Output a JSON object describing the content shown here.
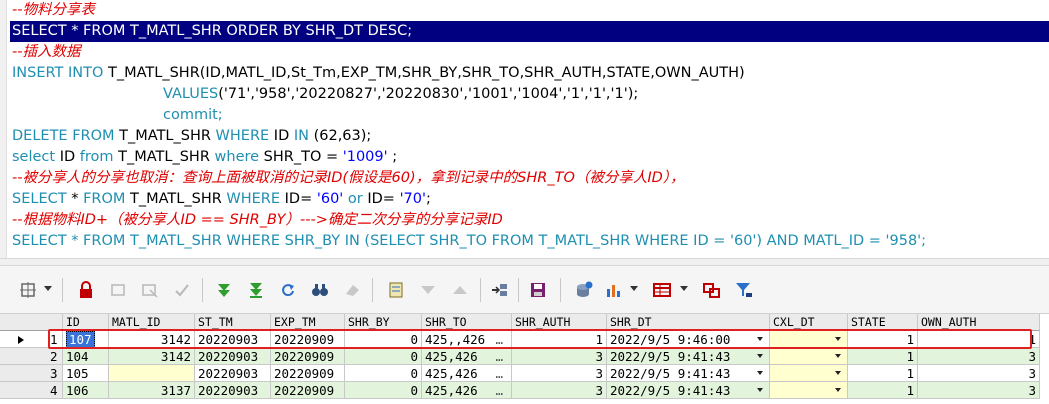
{
  "editor": {
    "lines": [
      {
        "kind": "comment",
        "text": "--物料分享表"
      },
      {
        "kind": "selected",
        "text": "SELECT * FROM T_MATL_SHR ORDER BY SHR_DT DESC;"
      },
      {
        "kind": "comment",
        "text": "--插入数据"
      },
      {
        "kind": "insert",
        "kw": "INSERT INTO",
        "rest": " T_MATL_SHR(ID,MATL_ID,St_Tm,EXP_TM,SHR_BY,SHR_TO,SHR_AUTH,STATE,OWN_AUTH)"
      },
      {
        "kind": "values",
        "kw": "VALUES",
        "rest": "('71','958','20220827','20220830','1001','1004','1','1','1');"
      },
      {
        "kind": "commit",
        "text": "commit;"
      },
      {
        "kind": "delete",
        "kw": "DELETE FROM",
        "rest": " T_MATL_SHR ",
        "kw2": "WHERE",
        "rest2": " ID ",
        "kw3": "IN",
        "rest3": " (62,63);"
      },
      {
        "kind": "select2",
        "kw": "select",
        "rest": " ID ",
        "kw2": "from",
        "rest2": " T_MATL_SHR ",
        "kw3": "where",
        "rest3": " SHR_TO = ",
        "str": "'1009'",
        "rest4": " ;"
      },
      {
        "kind": "comment",
        "text": "--被分享人的分享也取消：查询上面被取消的记录ID(假设是60)，拿到记录中的SHR_TO（被分享人ID），"
      },
      {
        "kind": "select3",
        "kw": "SELECT",
        "rest": " * ",
        "kw2": "FROM",
        "rest2": " T_MATL_SHR ",
        "kw3": "WHERE",
        "rest3": " ID= ",
        "str": "'60'",
        "kw4": " or ",
        "rest4": "ID= ",
        "str2": "'70'",
        "rest5": ";"
      },
      {
        "kind": "comment",
        "text": "--根据物料ID+（被分享人ID == SHR_BY）--->确定二次分享的分享记录ID"
      },
      {
        "kind": "select4",
        "text": "SELECT * FROM T_MATL_SHR WHERE SHR_BY IN (SELECT SHR_TO FROM T_MATL_SHR WHERE ID = '60') AND MATL_ID = '958';"
      }
    ]
  },
  "grid": {
    "columns": [
      "",
      "ID",
      "MATL_ID",
      "ST_TM",
      "EXP_TM",
      "SHR_BY",
      "SHR_TO",
      "SHR_AUTH",
      "SHR_DT",
      "CXL_DT",
      "STATE",
      "OWN_AUTH"
    ],
    "rows": [
      {
        "num": "1",
        "id": "107",
        "matl": "3142",
        "st": "20220903",
        "exp": "20220909",
        "by": "0",
        "to": "425,,426",
        "auth": "1",
        "dt": "2022/9/5 9:46:00",
        "cxl": "",
        "state": "1",
        "own": "1"
      },
      {
        "num": "2",
        "id": "104",
        "matl": "3142",
        "st": "20220903",
        "exp": "20220909",
        "by": "0",
        "to": "425,426",
        "auth": "3",
        "dt": "2022/9/5 9:41:43",
        "cxl": "",
        "state": "1",
        "own": "3"
      },
      {
        "num": "3",
        "id": "105",
        "matl": "",
        "st": "20220903",
        "exp": "20220909",
        "by": "0",
        "to": "425,426",
        "auth": "3",
        "dt": "2022/9/5 9:41:43",
        "cxl": "",
        "state": "1",
        "own": "3"
      },
      {
        "num": "4",
        "id": "106",
        "matl": "3137",
        "st": "20220903",
        "exp": "20220909",
        "by": "0",
        "to": "425,426",
        "auth": "3",
        "dt": "2022/9/5 9:41:43",
        "cxl": "",
        "state": "1",
        "own": "3"
      }
    ],
    "ellipsis": "…"
  },
  "colors": {
    "comment": "#e00000",
    "keyword": "#0000c0",
    "selection": "#000080",
    "highlight_box": "#e02020",
    "row_alt": "#e3f4dc"
  },
  "toolbar": {
    "icons": [
      "grid-menu-icon",
      "lock-icon",
      "new-record-icon",
      "delete-record-icon",
      "post-icon",
      "first-record-icon",
      "last-record-icon",
      "refresh-icon",
      "find-icon",
      "clear-icon",
      "query-by-example-icon",
      "next-icon",
      "prev-icon",
      "link-icon",
      "save-icon",
      "export-icon",
      "chart-icon",
      "table-view-icon",
      "record-view-icon",
      "filter-icon"
    ]
  }
}
